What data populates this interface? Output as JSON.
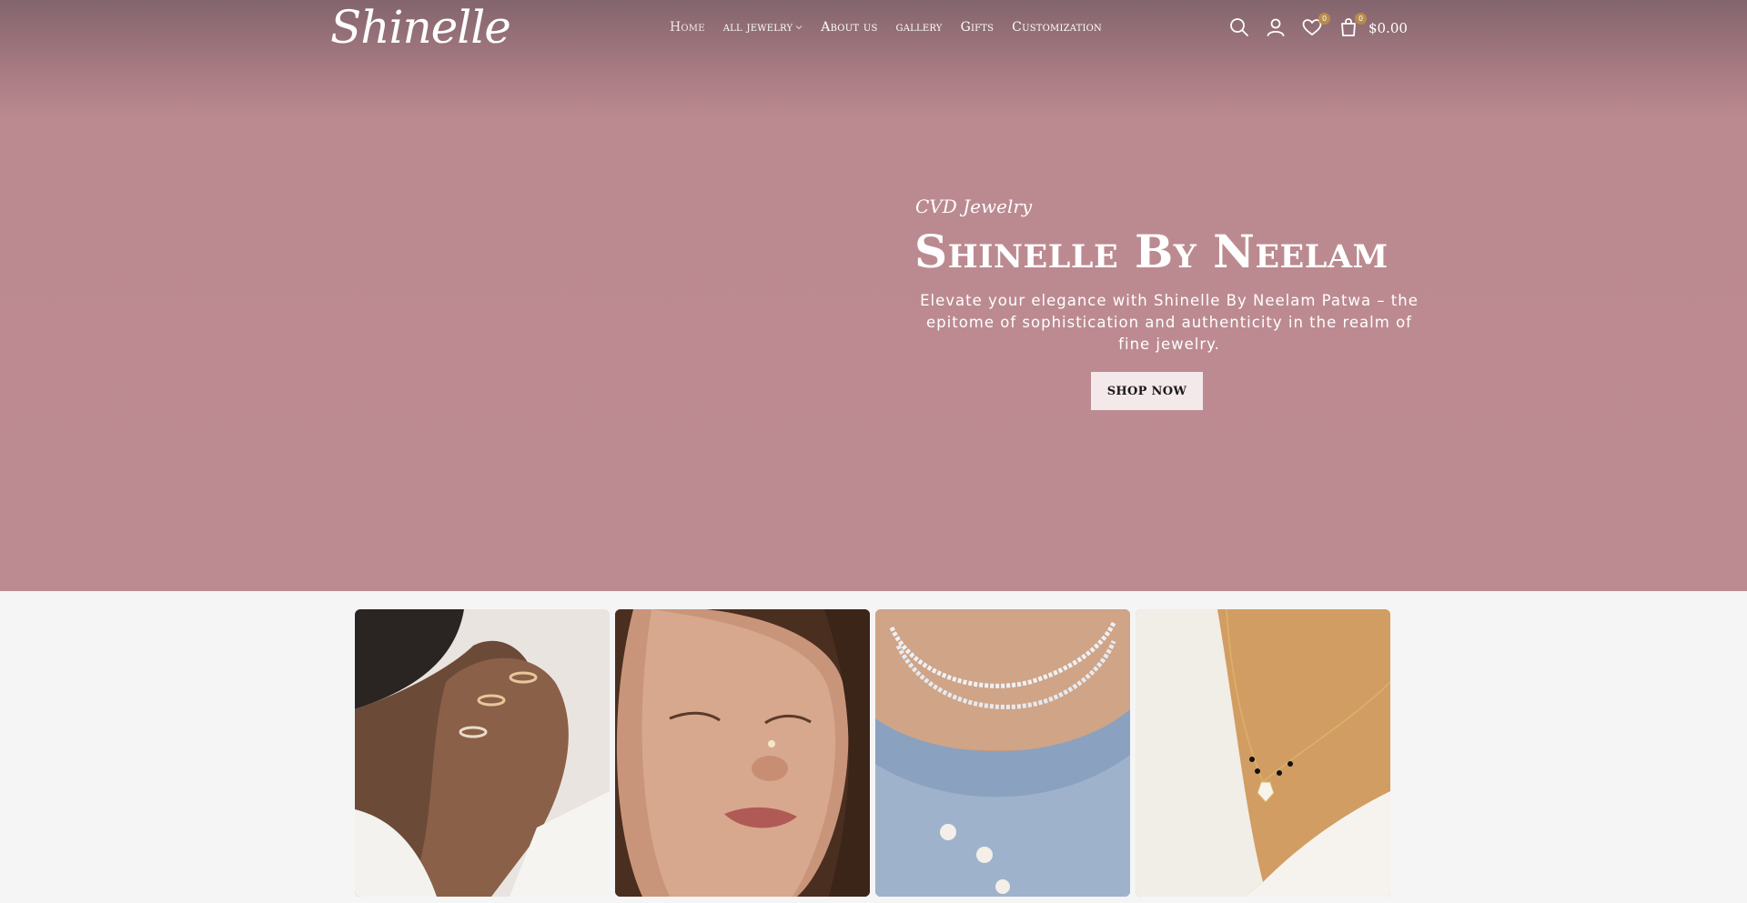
{
  "brand": {
    "logo_text": "Shinelle"
  },
  "nav": {
    "items": [
      {
        "label": "Home"
      },
      {
        "label": "all jewelry"
      },
      {
        "label": "About us"
      },
      {
        "label": "gallery"
      },
      {
        "label": "Gifts"
      },
      {
        "label": "Customization"
      }
    ]
  },
  "header_tools": {
    "icons": [
      "search-icon",
      "user-icon",
      "heart-icon",
      "bag-icon"
    ],
    "wishlist_count": "0",
    "cart_count": "0",
    "cart_total": "$0.00"
  },
  "hero": {
    "eyebrow": "CVD Jewelry",
    "title": "Shinelle By Neelam",
    "description": "Elevate your elegance with Shinelle By Neelam Patwa – the epitome of sophistication and authenticity in the realm of fine jewelry.",
    "cta_label": "SHOP NOW"
  },
  "colors": {
    "hero_bg": "#bc8b91",
    "header_bg": "#83656d",
    "cta_bg": "#f3e8ea",
    "badge": "#b88b4a"
  }
}
